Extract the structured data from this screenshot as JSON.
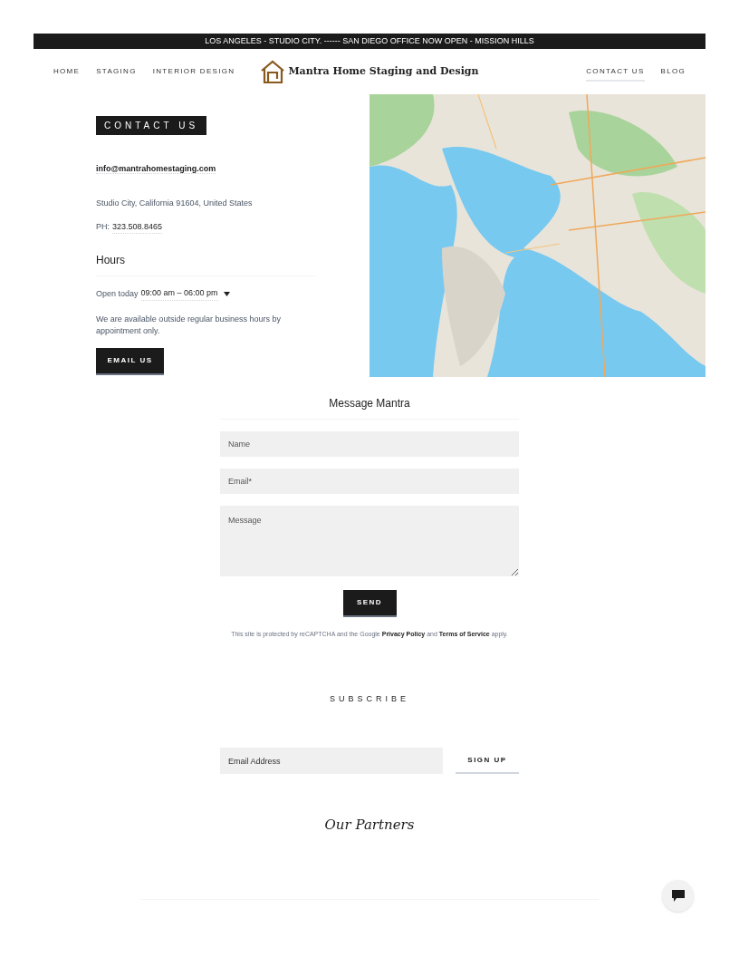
{
  "announcement": "LOS ANGELES - STUDIO CITY. ------ SAN DIEGO OFFICE NOW OPEN - MISSION HILLS",
  "nav_left": [
    {
      "label": "HOME",
      "selected": false
    },
    {
      "label": "STAGING",
      "selected": false
    },
    {
      "label": "INTERIOR DESIGN",
      "selected": false
    }
  ],
  "site_title": "Mantra Home Staging and Design",
  "nav_right": [
    {
      "label": "CONTACT US",
      "selected": true
    },
    {
      "label": "BLOG",
      "selected": false
    }
  ],
  "contact": {
    "heading": "CONTACT US",
    "email": "info@mantrahomestaging.com",
    "address": "Studio City, California 91604, United States",
    "phone_label": "PH:",
    "phone": "323.508.8465",
    "hours_heading": "Hours",
    "open_label": "Open today",
    "hours": "09:00 am – 06:00 pm",
    "note": "We are available outside regular business hours by appointment only.",
    "button": "EMAIL US"
  },
  "form": {
    "title": "Message Mantra",
    "fields": [
      {
        "placeholder": "Name",
        "kind": "input"
      },
      {
        "placeholder": "Email*",
        "kind": "input"
      },
      {
        "placeholder": "Message",
        "kind": "textarea"
      }
    ],
    "button": "SEND",
    "recaptcha_text": "This site is protected by reCAPTCHA and the Google",
    "privacy_link": "Privacy Policy",
    "and_text": "and",
    "terms_link": "Terms of Service",
    "apply_text": "apply."
  },
  "subscribe": {
    "heading": "SUBSCRIBE",
    "placeholder": "Email Address",
    "button": "SIGN UP"
  },
  "partners": {
    "heading": "Our Partners"
  }
}
